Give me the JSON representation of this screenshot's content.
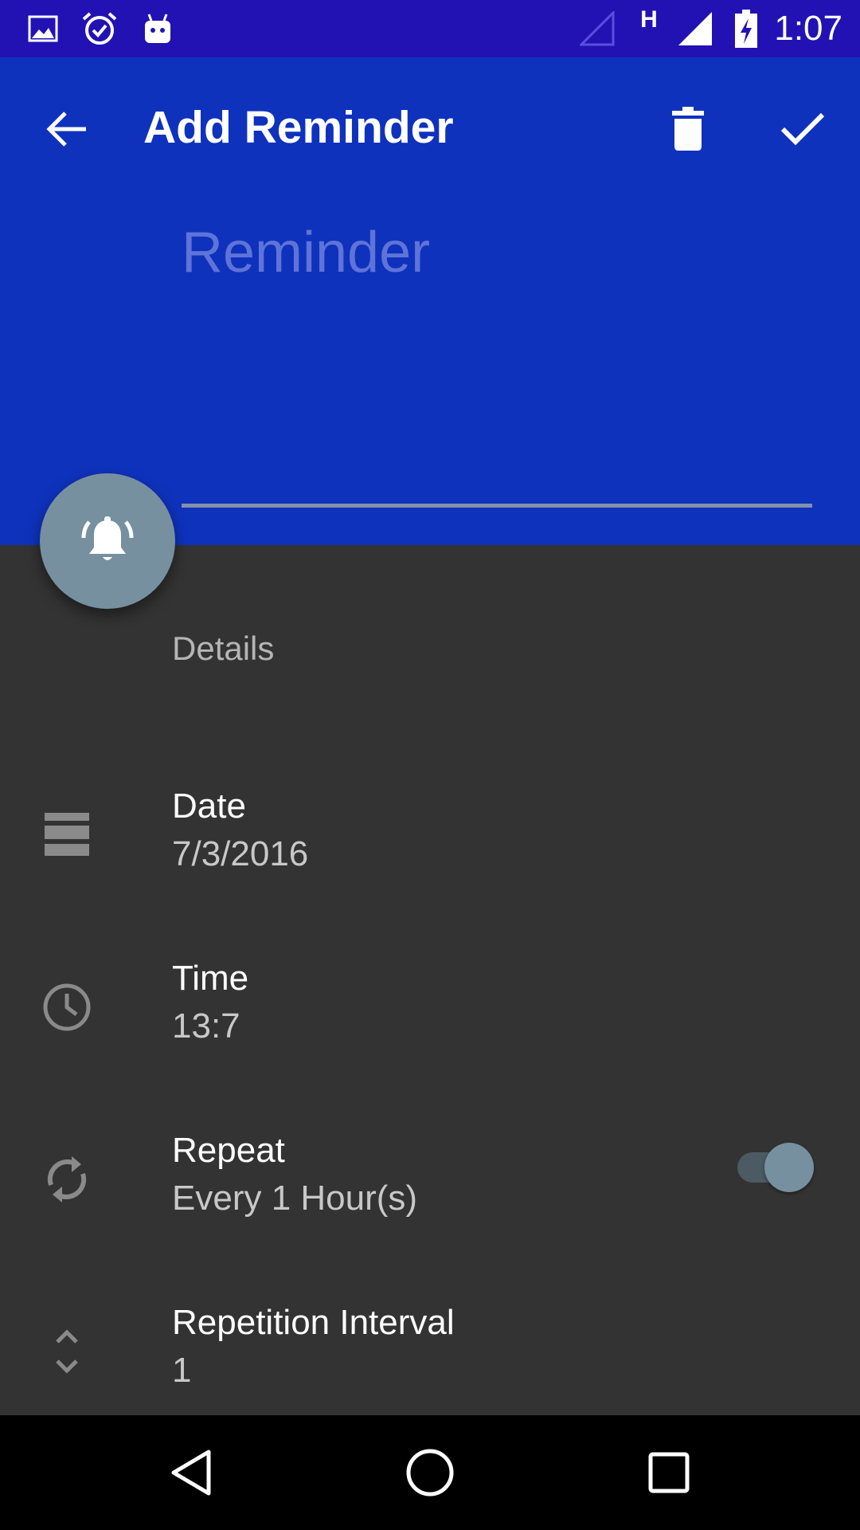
{
  "status_bar": {
    "time": "1:07",
    "network_type": "H",
    "icons": [
      "image-icon",
      "alarm-icon",
      "android-icon",
      "signal-empty-icon",
      "signal-icon",
      "battery-charging-icon"
    ],
    "background": "#2212b4"
  },
  "app_bar": {
    "title": "Add Reminder",
    "back_icon": "arrow-back-icon",
    "delete_icon": "delete-icon",
    "done_icon": "check-icon",
    "background": "#0f32bd"
  },
  "reminder_field": {
    "placeholder": "Reminder",
    "value": ""
  },
  "fab": {
    "icon": "bell-ringing-icon",
    "color": "#76909f"
  },
  "details": {
    "header": "Details",
    "date": {
      "label": "Date",
      "value": "7/3/2016",
      "icon": "calendar-icon"
    },
    "time": {
      "label": "Time",
      "value": "13:7",
      "icon": "clock-icon"
    },
    "repeat": {
      "label": "Repeat",
      "value": "Every 1 Hour(s)",
      "icon": "repeat-icon",
      "enabled": true
    },
    "interval": {
      "label": "Repetition Interval",
      "value": "1",
      "icon": "unfold-icon"
    }
  },
  "nav_bar": {
    "icons": [
      "nav-back-icon",
      "nav-home-icon",
      "nav-recents-icon"
    ]
  },
  "colors": {
    "content_background": "#333333",
    "accent": "#76909f"
  }
}
